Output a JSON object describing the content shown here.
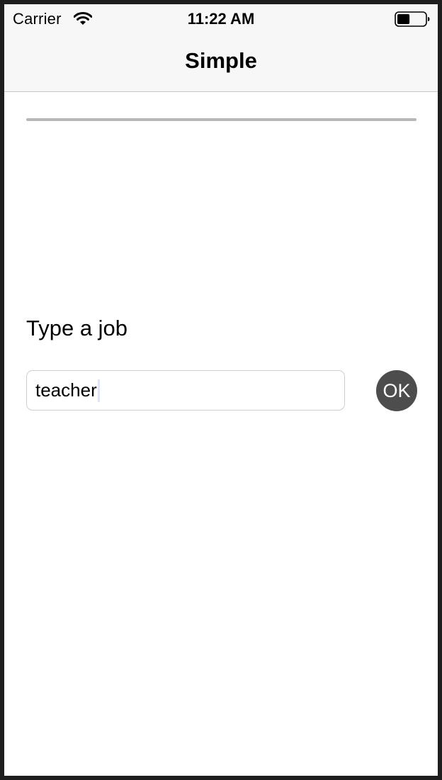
{
  "status_bar": {
    "carrier": "Carrier",
    "time": "11:22 AM",
    "wifi_icon": "wifi-icon",
    "battery_icon": "battery-icon",
    "battery_level_fraction": 0.45
  },
  "nav": {
    "title": "Simple"
  },
  "progress": {
    "value_fraction": 0.0,
    "track_color": "#b7b7b7",
    "fill_color": "#007aff"
  },
  "form": {
    "prompt": "Type a job",
    "input_value": "teacher",
    "ok_label": "OK",
    "ok_color": "#4d4d4d"
  }
}
